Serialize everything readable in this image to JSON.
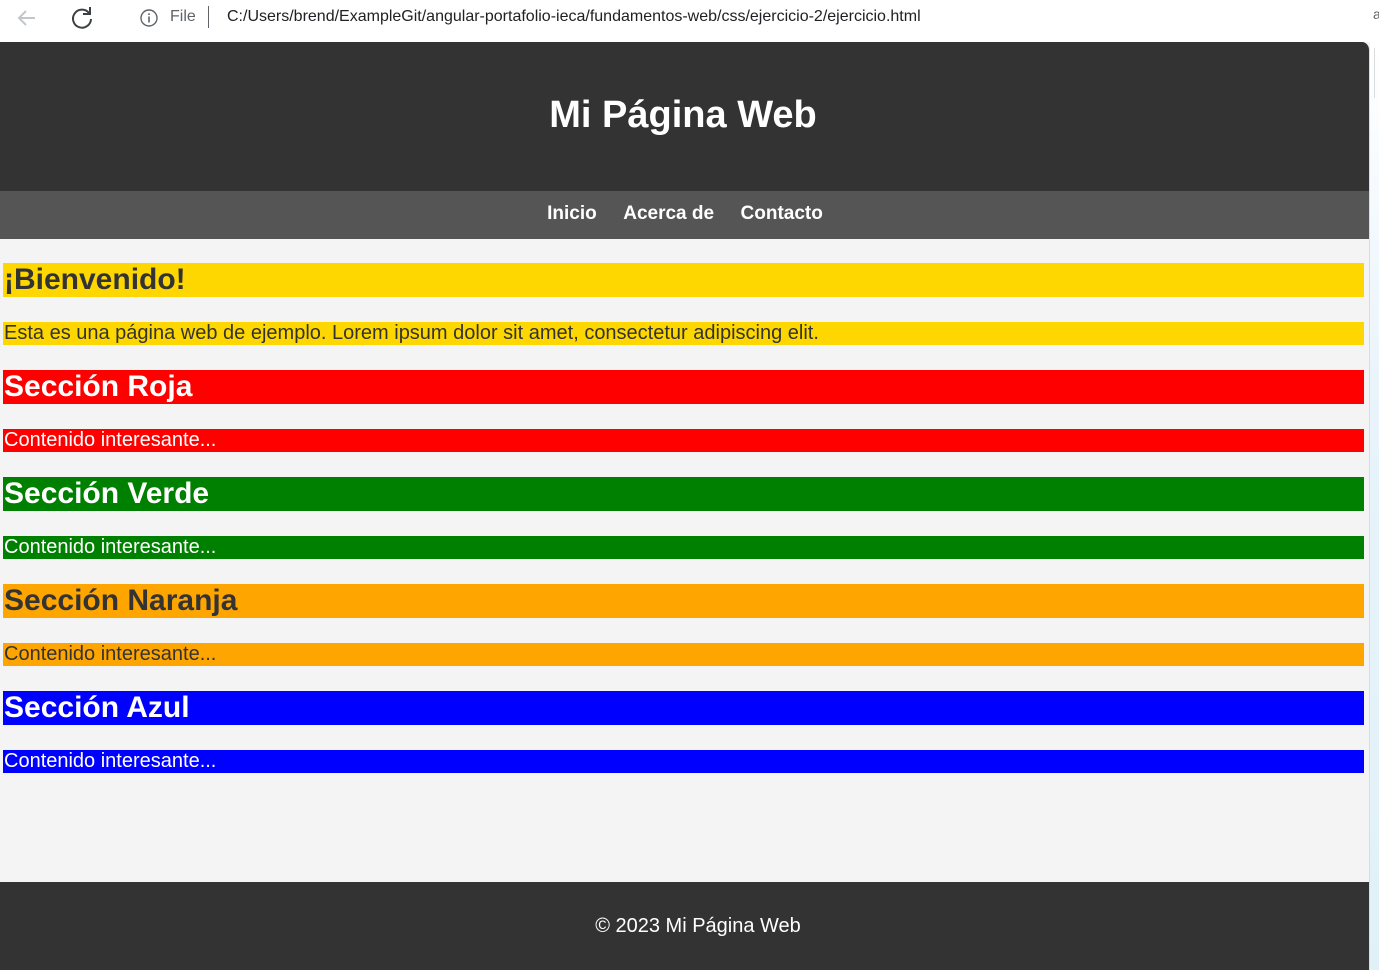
{
  "browser": {
    "file_label": "File",
    "url": "C:/Users/brend/ExampleGit/angular-portafolio-ieca/fundamentos-web/css/ejercicio-2/ejercicio.html",
    "edge_letter": "a"
  },
  "header": {
    "title": "Mi Página Web"
  },
  "nav": {
    "items": [
      {
        "label": "Inicio"
      },
      {
        "label": "Acerca de"
      },
      {
        "label": "Contacto"
      }
    ]
  },
  "sections": [
    {
      "heading": "¡Bienvenido!",
      "text": "Esta es una página web de ejemplo. Lorem ipsum dolor sit amet, consectetur adipiscing elit.",
      "bg": "#ffd700",
      "color": "#333333"
    },
    {
      "heading": "Sección Roja",
      "text": "Contenido interesante...",
      "bg": "#ff0000",
      "color": "#ffffff"
    },
    {
      "heading": "Sección Verde",
      "text": "Contenido interesante...",
      "bg": "#008000",
      "color": "#ffffff"
    },
    {
      "heading": "Sección Naranja",
      "text": "Contenido interesante...",
      "bg": "#ffa500",
      "color": "#333333"
    },
    {
      "heading": "Sección Azul",
      "text": "Contenido interesante...",
      "bg": "#0000ff",
      "color": "#ffffff"
    }
  ],
  "footer": {
    "text": "© 2023 Mi Página Web"
  },
  "colors": {
    "header_bg": "#333333",
    "nav_bg": "#555555",
    "page_bg": "#f4f4f4"
  }
}
